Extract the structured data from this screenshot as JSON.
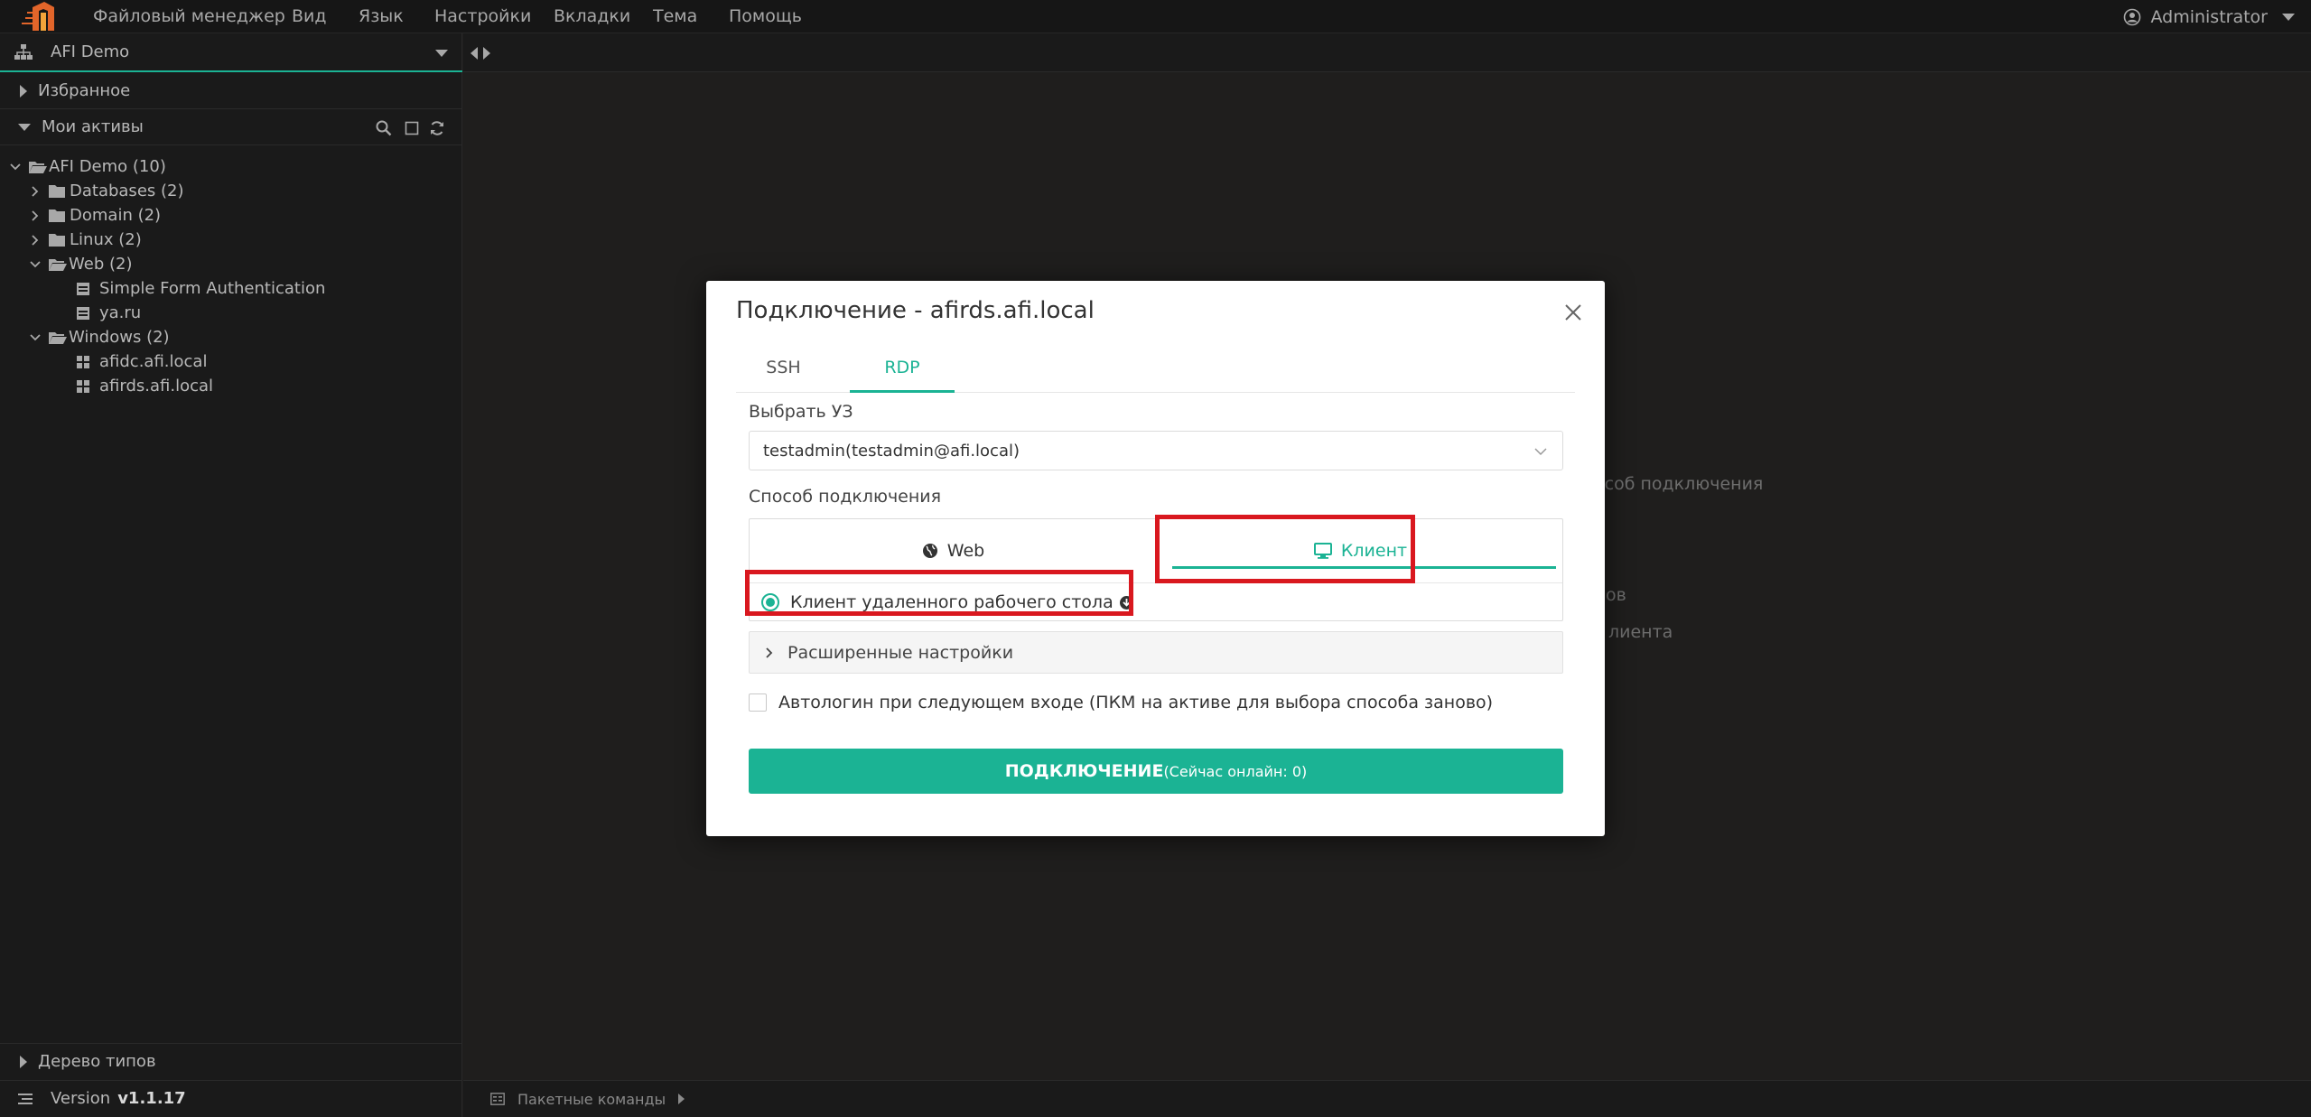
{
  "menu": {
    "items": [
      "Файловый менеджер",
      "Вид",
      "Язык",
      "Настройки",
      "Вкладки",
      "Тема",
      "Помощь"
    ],
    "user": "Administrator"
  },
  "sidebar": {
    "org": "AFI Demo",
    "favorites": "Избранное",
    "my_assets": "Мои активы",
    "tree": [
      {
        "label": "AFI Demo (10)",
        "type": "folder-open",
        "expanded": true
      },
      {
        "label": "Databases (2)",
        "type": "folder",
        "expanded": false
      },
      {
        "label": "Domain (2)",
        "type": "folder",
        "expanded": false
      },
      {
        "label": "Linux (2)",
        "type": "folder",
        "expanded": false
      },
      {
        "label": "Web (2)",
        "type": "folder-open",
        "expanded": true
      },
      {
        "label": "Simple Form Authentication",
        "type": "asset-web"
      },
      {
        "label": "ya.ru",
        "type": "asset-web"
      },
      {
        "label": "Windows (2)",
        "type": "folder-open",
        "expanded": true
      },
      {
        "label": "afidc.afi.local",
        "type": "asset-windows"
      },
      {
        "label": "afirds.afi.local",
        "type": "asset-windows"
      }
    ],
    "type_tree": "Дерево типов",
    "version_label": "Version",
    "version_value": "v1.1.17"
  },
  "background": {
    "fragments": [
      "особ подключения",
      "ов",
      "лиента"
    ]
  },
  "statusbar": {
    "batch_commands": "Пакетные команды"
  },
  "modal": {
    "title": "Подключение - afirds.afi.local",
    "tabs": [
      "SSH",
      "RDP"
    ],
    "active_tab": "RDP",
    "account_label": "Выбрать УЗ",
    "account_value": "testadmin(testadmin@afi.local)",
    "method_label": "Способ подключения",
    "method_web": "Web",
    "method_client": "Клиент",
    "active_method": "Клиент",
    "client_option": "Клиент удаленного рабочего стола",
    "advanced": "Расширенные настройки",
    "autologin": "Автологин при следующем входе (ПКМ на активе для выбора способа заново)",
    "connect_main": "ПОДКЛЮЧЕНИЕ",
    "connect_sub": "(Сейчас онлайн: 0)",
    "accent_color": "#1bb394",
    "highlight_color": "#d9181f"
  }
}
